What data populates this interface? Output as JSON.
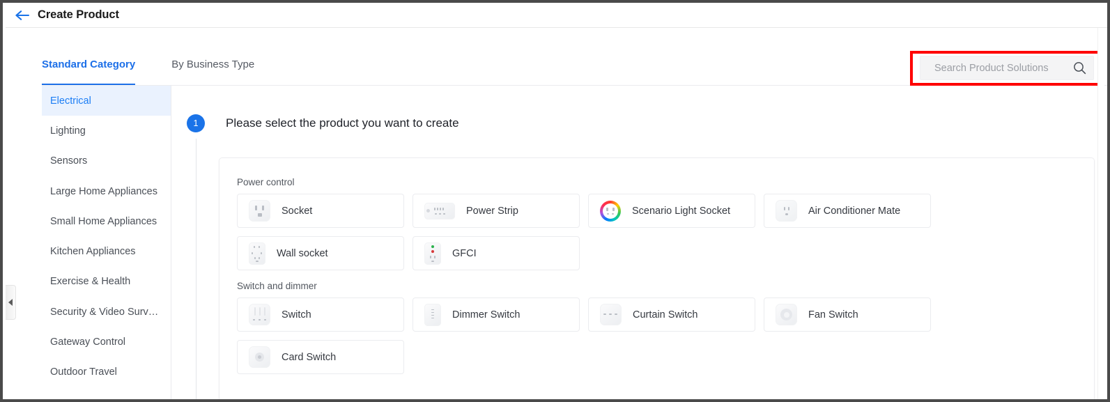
{
  "header": {
    "back_icon": "back-arrow-icon",
    "title": "Create Product"
  },
  "tabs": [
    {
      "label": "Standard Category",
      "active": true
    },
    {
      "label": "By Business Type",
      "active": false
    }
  ],
  "search": {
    "placeholder": "Search Product Solutions",
    "value": "",
    "icon": "search-icon",
    "highlight_color": "#ff0000"
  },
  "sidebar": {
    "items": [
      {
        "label": "Electrical",
        "active": true
      },
      {
        "label": "Lighting",
        "active": false
      },
      {
        "label": "Sensors",
        "active": false
      },
      {
        "label": "Large Home Appliances",
        "active": false
      },
      {
        "label": "Small Home Appliances",
        "active": false
      },
      {
        "label": "Kitchen Appliances",
        "active": false
      },
      {
        "label": "Exercise & Health",
        "active": false
      },
      {
        "label": "Security & Video Surv…",
        "active": false
      },
      {
        "label": "Gateway Control",
        "active": false
      },
      {
        "label": "Outdoor Travel",
        "active": false
      }
    ]
  },
  "collapse_handle": {
    "icon": "chevron-left-icon"
  },
  "step": {
    "number": "1",
    "text": "Please select the product you want to create"
  },
  "groups": [
    {
      "title": "Power control",
      "items": [
        {
          "label": "Socket",
          "icon": "socket-icon"
        },
        {
          "label": "Power Strip",
          "icon": "power-strip-icon"
        },
        {
          "label": "Scenario Light Socket",
          "icon": "scenario-light-socket-icon"
        },
        {
          "label": "Air Conditioner Mate",
          "icon": "air-conditioner-mate-icon"
        },
        {
          "label": "Wall socket",
          "icon": "wall-socket-icon"
        },
        {
          "label": "GFCI",
          "icon": "gfci-icon"
        }
      ]
    },
    {
      "title": "Switch and dimmer",
      "items": [
        {
          "label": "Switch",
          "icon": "switch-icon"
        },
        {
          "label": "Dimmer Switch",
          "icon": "dimmer-switch-icon"
        },
        {
          "label": "Curtain Switch",
          "icon": "curtain-switch-icon"
        },
        {
          "label": "Fan Switch",
          "icon": "fan-switch-icon"
        },
        {
          "label": "Card Switch",
          "icon": "card-switch-icon"
        }
      ]
    }
  ],
  "colors": {
    "accent": "#1c6fe8",
    "step_badge": "#1a73e8",
    "sidebar_active_bg": "#eaf2fe",
    "highlight": "#ff0000"
  }
}
